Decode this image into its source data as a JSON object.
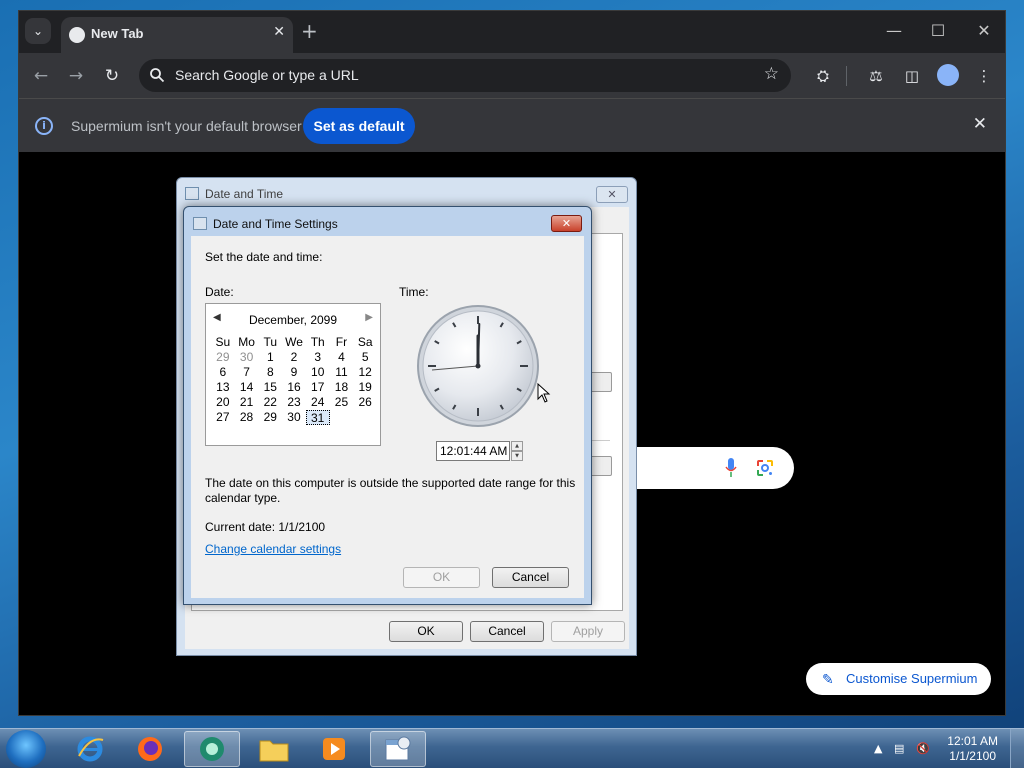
{
  "browser": {
    "tab_title": "New Tab",
    "new_tab_symbol": "+",
    "omnibox_placeholder": "Search Google or type a URL",
    "infobar_text": "Supermium isn't your default browser",
    "set_default_label": "Set as default",
    "customise_label": "Customise Supermium"
  },
  "outer_dialog": {
    "title": "Date and Time",
    "ok_label": "OK",
    "cancel_label": "Cancel",
    "apply_label": "Apply"
  },
  "inner_dialog": {
    "title": "Date and Time Settings",
    "instruction": "Set the date and time:",
    "date_label": "Date:",
    "time_label": "Time:",
    "calendar": {
      "month_year": "December, 2099",
      "weekdays": [
        "Su",
        "Mo",
        "Tu",
        "We",
        "Th",
        "Fr",
        "Sa"
      ],
      "weeks": [
        [
          "29",
          "30",
          "1",
          "2",
          "3",
          "4",
          "5"
        ],
        [
          "6",
          "7",
          "8",
          "9",
          "10",
          "11",
          "12"
        ],
        [
          "13",
          "14",
          "15",
          "16",
          "17",
          "18",
          "19"
        ],
        [
          "20",
          "21",
          "22",
          "23",
          "24",
          "25",
          "26"
        ],
        [
          "27",
          "28",
          "29",
          "30",
          "31",
          "",
          ""
        ]
      ],
      "selected_day": "31"
    },
    "time_value": "12:01:44 AM",
    "warning_line1": "The date on this computer is outside the supported date range for this",
    "warning_line2": "calendar type.",
    "current_date": "Current date: 1/1/2100",
    "change_calendar_link": "Change calendar settings",
    "ok_label": "OK",
    "cancel_label": "Cancel"
  },
  "taskbar": {
    "clock_time": "12:01 AM",
    "clock_date": "1/1/2100"
  },
  "colors": {
    "browser_frame": "#202124",
    "toolbar": "#35363a",
    "accent_blue": "#0b57d0",
    "link_blue": "#0066cc",
    "close_red": "#c8412b"
  }
}
